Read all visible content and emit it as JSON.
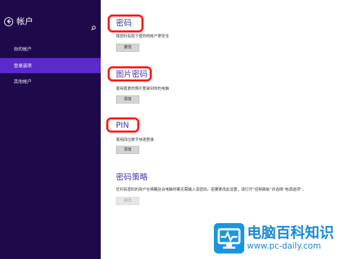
{
  "sidebar": {
    "title": "帐户",
    "back_icon": "back-arrow-icon",
    "search_icon": "search-icon",
    "items": [
      {
        "label": "你的帐户",
        "active": false
      },
      {
        "label": "登录选项",
        "active": true
      },
      {
        "label": "其他帐户",
        "active": false
      }
    ]
  },
  "sections": [
    {
      "title": "密码",
      "description": "强密码有助于使你的帐户更安全",
      "button": "更改",
      "highlighted": true,
      "button_enabled": true
    },
    {
      "title": "图片密码",
      "description": "使用喜爱的照片登录到你的电脑",
      "button": "添加",
      "highlighted": true,
      "button_enabled": true
    },
    {
      "title": "PIN",
      "description": "使用四位数字快速登录",
      "button": "添加",
      "highlighted": true,
      "button_enabled": true
    },
    {
      "title": "密码策略",
      "description": "任何有密码的用户在唤醒这台电脑时都无需输入该密码。若要更改此设置，请打开“控制面板”并选择“电源选项”。",
      "button": "更改",
      "highlighted": false,
      "button_enabled": false
    }
  ],
  "watermark": {
    "text": "电脑百科知识",
    "url": "www.pc-daily.com",
    "icon": "monitor-pulse-icon"
  },
  "colors": {
    "sidebar_bg": "#1e0a4a",
    "sidebar_active": "#5a2bc9",
    "section_title": "#4a3aa0",
    "highlight_border": "#ff1a1a",
    "watermark_blue": "#1a88d8"
  }
}
